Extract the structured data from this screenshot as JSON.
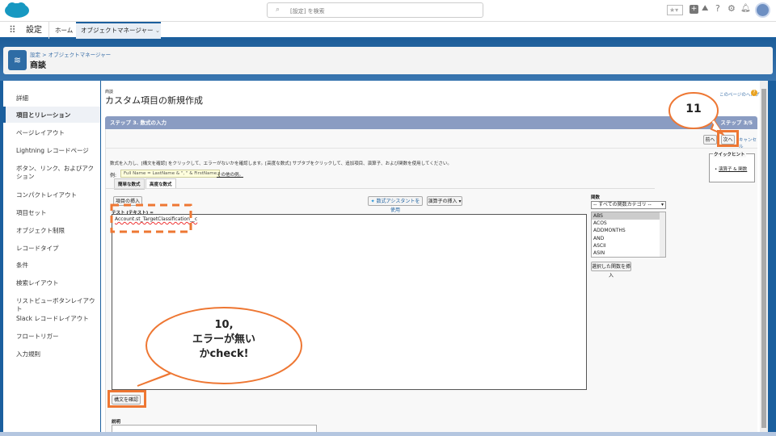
{
  "header": {
    "search_placeholder": "[設定] を検索"
  },
  "nav": {
    "app": "設定",
    "home": "ホーム",
    "tab": "オブジェクトマネージャー"
  },
  "object": {
    "breadcrumb": "設定 > オブジェクトマネージャー",
    "title": "商談"
  },
  "sidebar": {
    "items": [
      "詳細",
      "項目とリレーション",
      "ページレイアウト",
      "Lightning レコードページ",
      "ボタン、リンク、およびアクション",
      "コンパクトレイアウト",
      "項目セット",
      "オブジェクト制限",
      "レコードタイプ",
      "条件",
      "検索レイアウト",
      "リストビューボタンレイアウト",
      "Slack レコードレイアウト",
      "フロートリガー",
      "入力規則"
    ]
  },
  "page": {
    "object_label": "商談",
    "title": "カスタム項目の新規作成",
    "help": "このページのヘルプ",
    "step_title": "ステップ 3. 数式の入力",
    "step_count": "ステップ 3/5",
    "prev": "前へ",
    "next": "次へ",
    "cancel": "キャンセル",
    "instructions": "数式を入力し、[構文を確認] をクリックして、エラーがないかを確認します。[高度な数式] サブタブをクリックして、追加項目、演算子、および関数を使用してください。",
    "example_label": "例:",
    "example": "Full Name = LastName & \", \" & FirstName",
    "more_examples": "その他の例。",
    "tabs": [
      "簡単な数式",
      "高度な数式"
    ],
    "insert_field": "項目の挿入",
    "formula_assistant": "数式アシスタントを使用",
    "insert_operator": "演算子の挿入",
    "field_label": "テスト (テキスト) =",
    "formula": "Account.st_TargetClassification__c",
    "quick_tips_title": "クイックヒント",
    "quick_tip": "演算子 & 関数",
    "functions_label": "関数",
    "function_category": "-- すべての関数カテゴリ --",
    "functions": [
      "ABS",
      "ACOS",
      "ADDMONTHS",
      "AND",
      "ASCII",
      "ASIN"
    ],
    "insert_function": "選択した関数を挿入",
    "check_syntax": "構文を確認",
    "description_label": "説明"
  },
  "annotations": {
    "step11": "11",
    "step10_line1": "10,",
    "step10_line2": "エラーが無い",
    "step10_line3": "かcheck!"
  }
}
